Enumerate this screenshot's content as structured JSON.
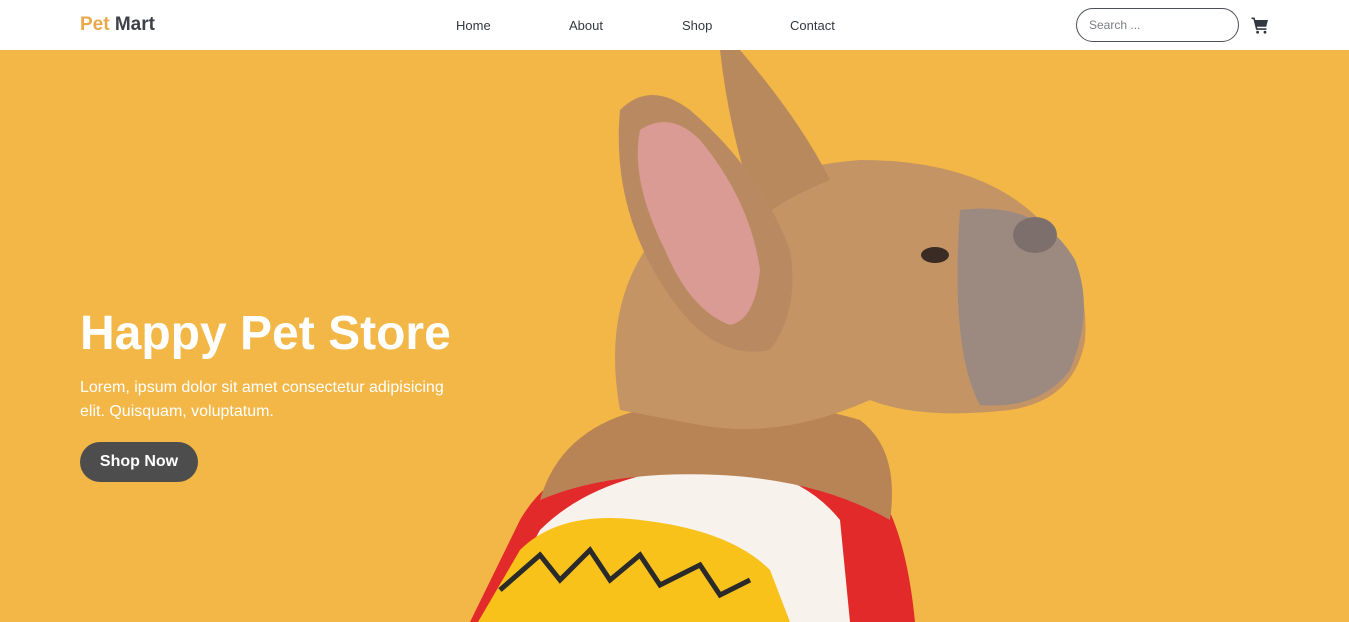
{
  "brand": {
    "part1": "Pet",
    "part2": "Mart"
  },
  "nav": {
    "home": "Home",
    "about": "About",
    "shop": "Shop",
    "contact": "Contact"
  },
  "search": {
    "placeholder": "Search ..."
  },
  "hero": {
    "title": "Happy Pet Store",
    "text": "Lorem, ipsum dolor sit amet consectetur adipisicing elit. Quisquam, voluptatum.",
    "button": "Shop Now"
  },
  "icons": {
    "cart": "shopping-cart-icon"
  },
  "colors": {
    "brand_accent": "#e9a94a",
    "brand_dark": "#3e4148",
    "hero_background": "#f2b746",
    "button_background": "#4d4d4d"
  }
}
